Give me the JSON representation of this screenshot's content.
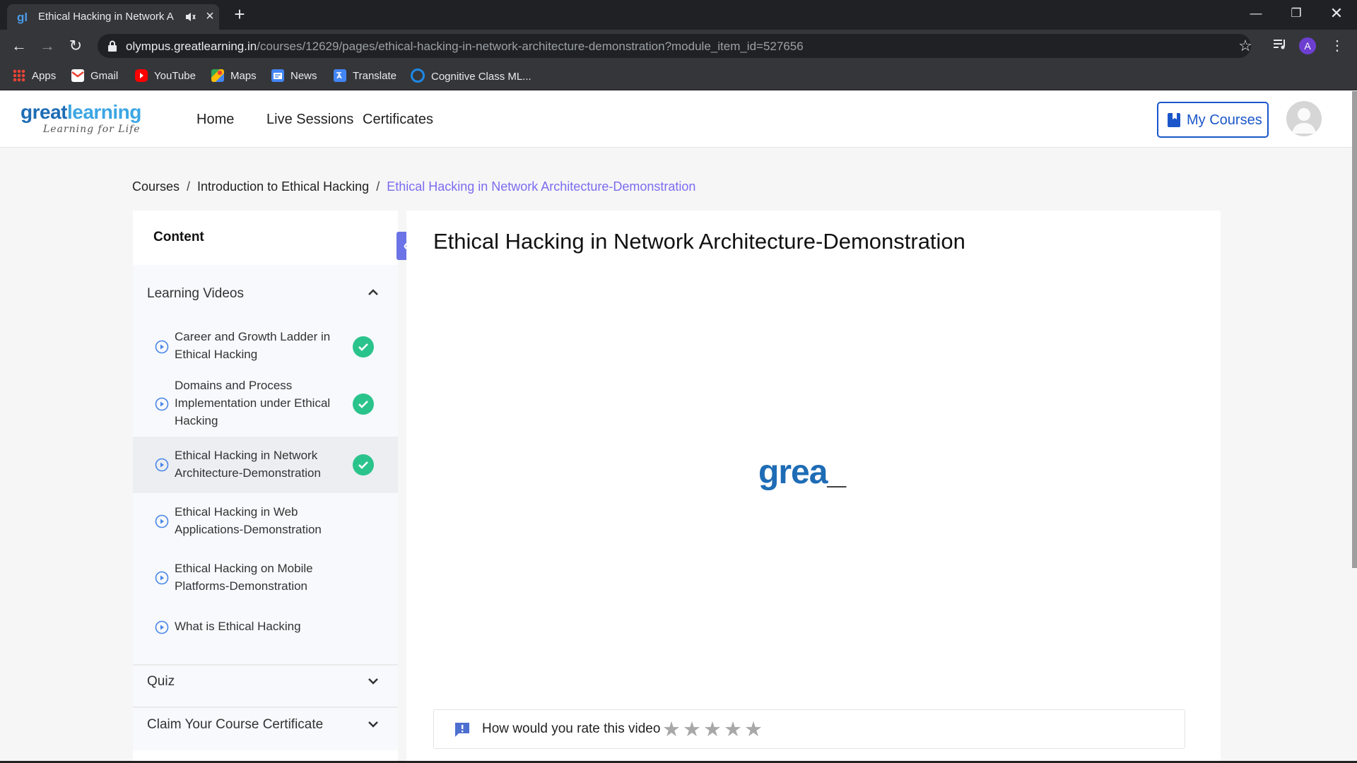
{
  "browser": {
    "tab_title": "Ethical Hacking in Network A",
    "tab_favicon": "gl",
    "url_host": "olympus.greatlearning.in",
    "url_path": "/courses/12629/pages/ethical-hacking-in-network-architecture-demonstration?module_item_id=527656",
    "profile_initial": "A",
    "bookmarks": [
      "Apps",
      "Gmail",
      "YouTube",
      "Maps",
      "News",
      "Translate",
      "Cognitive Class ML..."
    ]
  },
  "site": {
    "logo_great": "great",
    "logo_learning": "learning",
    "logo_tagline": "Learning for Life",
    "nav": [
      "Home",
      "Live Sessions",
      "Certificates"
    ],
    "my_courses_label": "My Courses"
  },
  "breadcrumb": [
    "Courses",
    "Introduction to Ethical Hacking",
    "Ethical Hacking in Network Architecture-Demonstration"
  ],
  "sidebar": {
    "title": "Content",
    "sections": [
      {
        "label": "Learning Videos",
        "expanded": true
      },
      {
        "label": "Quiz",
        "expanded": false
      },
      {
        "label": "Claim Your Course Certificate",
        "expanded": false
      }
    ],
    "items": [
      {
        "label": "Career and Growth Ladder in Ethical Hacking",
        "completed": true,
        "active": false
      },
      {
        "label": "Domains and Process Implementation under Ethical Hacking",
        "completed": true,
        "active": false
      },
      {
        "label": "Ethical Hacking in Network Architecture-Demonstration",
        "completed": true,
        "active": true
      },
      {
        "label": "Ethical Hacking in Web Applications-Demonstration",
        "completed": false,
        "active": false
      },
      {
        "label": "Ethical Hacking on Mobile Platforms-Demonstration",
        "completed": false,
        "active": false
      },
      {
        "label": "What is Ethical Hacking",
        "completed": false,
        "active": false
      }
    ]
  },
  "main": {
    "title": "Ethical Hacking in Network Architecture-Demonstration",
    "video_logo_text": "grea",
    "rating_prompt": "How would you rate this video",
    "stars": "★★★★★",
    "star_count": 5
  },
  "colors": {
    "accent": "#1a56c9",
    "breadcrumb_current": "#7b6cf0",
    "complete_green": "#2bc38c",
    "collapse_button": "#6b73e6"
  }
}
